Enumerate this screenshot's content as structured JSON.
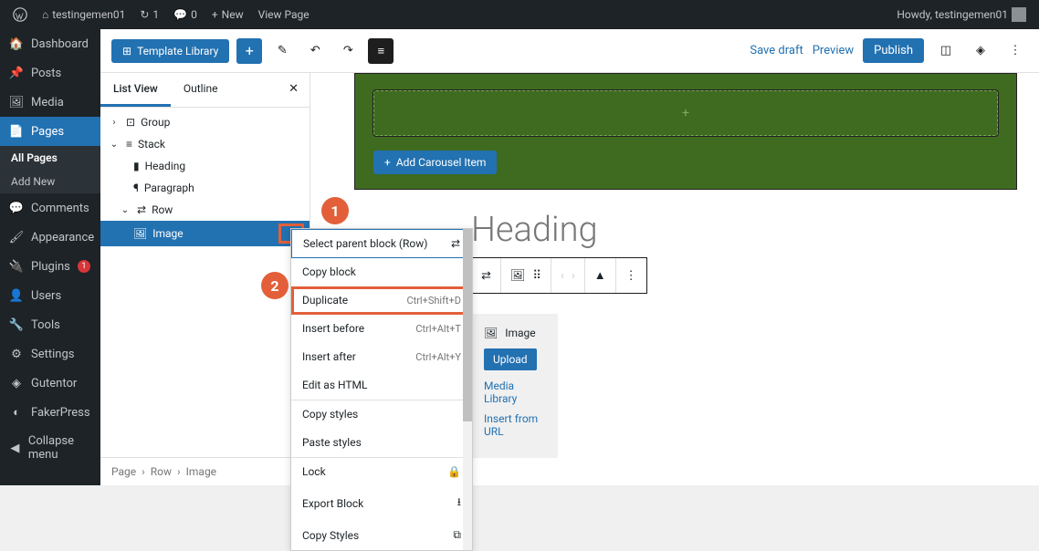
{
  "admin_bar": {
    "site_name": "testingemen01",
    "pending": "1",
    "comments": "0",
    "new": "New",
    "view": "View Page",
    "howdy": "Howdy, testingemen01"
  },
  "sidebar": {
    "items": [
      {
        "icon": "dashboard",
        "label": "Dashboard"
      },
      {
        "icon": "pin",
        "label": "Posts"
      },
      {
        "icon": "media",
        "label": "Media"
      },
      {
        "icon": "pages",
        "label": "Pages"
      },
      {
        "icon": "comments",
        "label": "Comments"
      },
      {
        "icon": "brush",
        "label": "Appearance"
      },
      {
        "icon": "plug",
        "label": "Plugins"
      },
      {
        "icon": "user",
        "label": "Users"
      },
      {
        "icon": "wrench",
        "label": "Tools"
      },
      {
        "icon": "sliders",
        "label": "Settings"
      },
      {
        "icon": "gutentor",
        "label": "Gutentor"
      },
      {
        "icon": "faker",
        "label": "FakerPress"
      },
      {
        "icon": "collapse",
        "label": "Collapse menu"
      }
    ],
    "submenu": {
      "all_pages": "All Pages",
      "add_new": "Add New"
    },
    "plugins_badge": "1"
  },
  "topbar": {
    "template_library": "Template Library",
    "save_draft": "Save draft",
    "preview": "Preview",
    "publish": "Publish"
  },
  "list_panel": {
    "tab_list": "List View",
    "tab_outline": "Outline",
    "tree": {
      "group": "Group",
      "stack": "Stack",
      "heading": "Heading",
      "paragraph": "Paragraph",
      "row": "Row",
      "image": "Image"
    },
    "breadcrumb": [
      "Page",
      "Row",
      "Image"
    ]
  },
  "canvas": {
    "add_carousel": "Add Carousel Item",
    "heading": "Heading",
    "image_block": {
      "title": "Image",
      "upload": "Upload",
      "media_library": "Media Library",
      "insert_url": "Insert from URL"
    }
  },
  "context_menu": {
    "select_parent": "Select parent block (Row)",
    "copy_block": "Copy block",
    "duplicate": "Duplicate",
    "duplicate_sc": "Ctrl+Shift+D",
    "insert_before": "Insert before",
    "insert_before_sc": "Ctrl+Alt+T",
    "insert_after": "Insert after",
    "insert_after_sc": "Ctrl+Alt+Y",
    "edit_html": "Edit as HTML",
    "copy_styles": "Copy styles",
    "paste_styles": "Paste styles",
    "lock": "Lock",
    "export": "Export Block",
    "copy_styles2": "Copy Styles"
  },
  "annotations": {
    "one": "1",
    "two": "2"
  }
}
